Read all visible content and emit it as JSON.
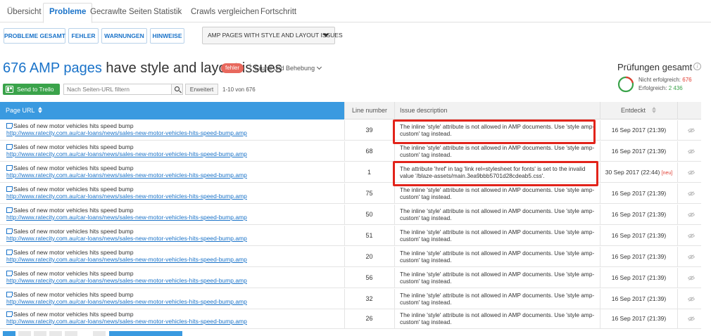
{
  "tabs": [
    "Übersicht",
    "Probleme",
    "Gecrawlte Seiten",
    "Statistik",
    "Crawls vergleichen",
    "Fortschritt"
  ],
  "filters": {
    "buttons": [
      "PROBLEME GESAMT",
      "FEHLER",
      "WARNUNGEN",
      "HINWEISE"
    ],
    "dropdown": "AMP PAGES WITH STYLE AND LAYOUT ISSUES"
  },
  "headline": {
    "count": "676 AMP pages",
    "rest": " have style and layout issues",
    "badge": "fehler",
    "separator": "|",
    "reason_link": "Grund und Behebung"
  },
  "toolbar": {
    "trello": "Send to Trello",
    "search_placeholder": "Nach Seiten-URL filtern",
    "advanced": "Erweitert",
    "range": "1-10 von 676"
  },
  "summary": {
    "title": "Prüfungen gesamt",
    "failed_label": "Nicht erfolgreich:",
    "failed_value": "676",
    "ok_label": "Erfolgreich:",
    "ok_value": "2 436",
    "failed_color": "#e03c31",
    "ok_color": "#3aa34a"
  },
  "table": {
    "headers": {
      "url": "Page URL",
      "line": "Line number",
      "issue": "Issue description",
      "date": "Entdeckt"
    },
    "rows": [
      {
        "title": "Sales of new motor vehicles hits speed bump",
        "url": "http://www.ratecity.com.au/car-loans/news/sales-new-motor-vehicles-hits-speed-bump.amp",
        "line": "39",
        "issue": "The inline 'style' attribute is not allowed in AMP documents. Use 'style amp-custom' tag instead.",
        "date": "16 Sep 2017 (21:39)",
        "new": ""
      },
      {
        "title": "Sales of new motor vehicles hits speed bump",
        "url": "http://www.ratecity.com.au/car-loans/news/sales-new-motor-vehicles-hits-speed-bump.amp",
        "line": "68",
        "issue": "The inline 'style' attribute is not allowed in AMP documents. Use 'style amp-custom' tag instead.",
        "date": "16 Sep 2017 (21:39)",
        "new": ""
      },
      {
        "title": "Sales of new motor vehicles hits speed bump",
        "url": "http://www.ratecity.com.au/car-loans/news/sales-new-motor-vehicles-hits-speed-bump.amp",
        "line": "1",
        "issue": "The attribute 'href' in tag 'link rel=stylesheet for fonts' is set to the invalid value '/blaze-assets/main.3ea9bbb5701d28cdeab5.css'.",
        "date": "30 Sep 2017 (22:44)",
        "new": "[neu]"
      },
      {
        "title": "Sales of new motor vehicles hits speed bump",
        "url": "http://www.ratecity.com.au/car-loans/news/sales-new-motor-vehicles-hits-speed-bump.amp",
        "line": "75",
        "issue": "The inline 'style' attribute is not allowed in AMP documents. Use 'style amp-custom' tag instead.",
        "date": "16 Sep 2017 (21:39)",
        "new": ""
      },
      {
        "title": "Sales of new motor vehicles hits speed bump",
        "url": "http://www.ratecity.com.au/car-loans/news/sales-new-motor-vehicles-hits-speed-bump.amp",
        "line": "50",
        "issue": "The inline 'style' attribute is not allowed in AMP documents. Use 'style amp-custom' tag instead.",
        "date": "16 Sep 2017 (21:39)",
        "new": ""
      },
      {
        "title": "Sales of new motor vehicles hits speed bump",
        "url": "http://www.ratecity.com.au/car-loans/news/sales-new-motor-vehicles-hits-speed-bump.amp",
        "line": "51",
        "issue": "The inline 'style' attribute is not allowed in AMP documents. Use 'style amp-custom' tag instead.",
        "date": "16 Sep 2017 (21:39)",
        "new": ""
      },
      {
        "title": "Sales of new motor vehicles hits speed bump",
        "url": "http://www.ratecity.com.au/car-loans/news/sales-new-motor-vehicles-hits-speed-bump.amp",
        "line": "20",
        "issue": "The inline 'style' attribute is not allowed in AMP documents. Use 'style amp-custom' tag instead.",
        "date": "16 Sep 2017 (21:39)",
        "new": ""
      },
      {
        "title": "Sales of new motor vehicles hits speed bump",
        "url": "http://www.ratecity.com.au/car-loans/news/sales-new-motor-vehicles-hits-speed-bump.amp",
        "line": "56",
        "issue": "The inline 'style' attribute is not allowed in AMP documents. Use 'style amp-custom' tag instead.",
        "date": "16 Sep 2017 (21:39)",
        "new": ""
      },
      {
        "title": "Sales of new motor vehicles hits speed bump",
        "url": "http://www.ratecity.com.au/car-loans/news/sales-new-motor-vehicles-hits-speed-bump.amp",
        "line": "32",
        "issue": "The inline 'style' attribute is not allowed in AMP documents. Use 'style amp-custom' tag instead.",
        "date": "16 Sep 2017 (21:39)",
        "new": ""
      },
      {
        "title": "Sales of new motor vehicles hits speed bump",
        "url": "http://www.ratecity.com.au/car-loans/news/sales-new-motor-vehicles-hits-speed-bump.amp",
        "line": "26",
        "issue": "The inline 'style' attribute is not allowed in AMP documents. Use 'style amp-custom' tag instead.",
        "date": "16 Sep 2017 (21:39)",
        "new": ""
      }
    ]
  }
}
